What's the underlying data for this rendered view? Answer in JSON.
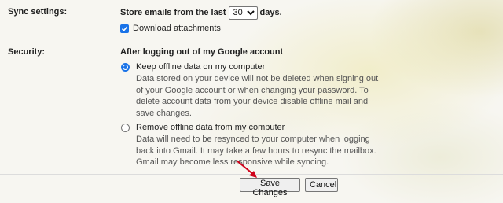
{
  "sync": {
    "label": "Sync settings:",
    "prefix": "Store emails from the last",
    "days_value": "30",
    "suffix": "days.",
    "download_label": "Download attachments",
    "download_checked": true
  },
  "security": {
    "label": "Security:",
    "heading": "After logging out of my Google account",
    "options": [
      {
        "title": "Keep offline data on my computer",
        "description": "Data stored on your device will not be deleted when signing out of your Google account or when changing your password. To delete account data from your device disable offline mail and save changes.",
        "selected": true
      },
      {
        "title": "Remove offline data from my computer",
        "description": "Data will need to be resynced to your computer when logging back into Gmail. It may take a few hours to resync the mailbox. Gmail may become less responsive while syncing.",
        "selected": false
      }
    ]
  },
  "actions": {
    "save_label": "Save Changes",
    "cancel_label": "Cancel"
  },
  "colors": {
    "accent": "#1a73e8",
    "annotation_arrow": "#d0021b"
  }
}
